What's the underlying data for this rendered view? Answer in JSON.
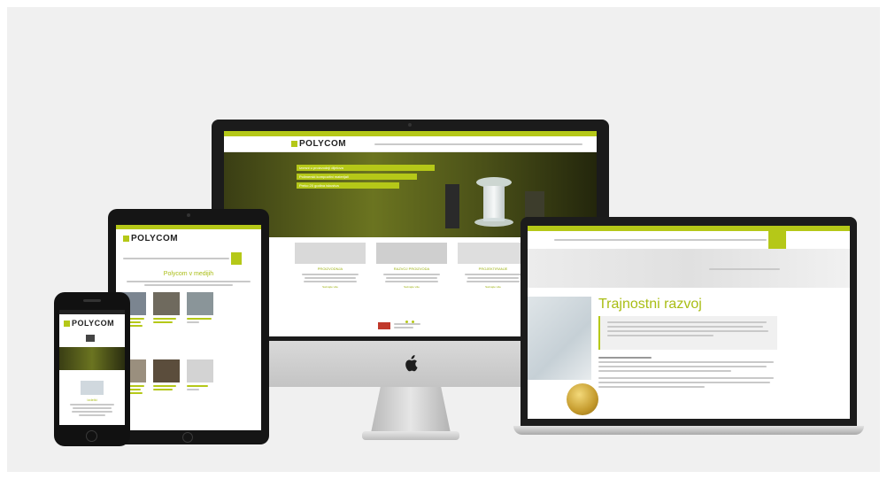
{
  "brand": {
    "name": "POLYCOM",
    "accent": "#b5c818"
  },
  "monitor": {
    "hero_bullets": [
      "Izvrsni u proizvodnji dijelova",
      "Polimerski kompozitni materijali",
      "Preko 20 godina iskustva"
    ],
    "cards": [
      {
        "title": "PROIZVODNJA",
        "button": "Saznajte više"
      },
      {
        "title": "RAZVOJ PROIZVODA",
        "button": "Saznajte više"
      },
      {
        "title": "PROJEKTIRANJE",
        "button": "Saznajte više"
      }
    ]
  },
  "laptop": {
    "page_title": "Trajnostni razvoj"
  },
  "tablet": {
    "section_title": "Polycom v medijih"
  },
  "phone": {
    "section_title": "Izdelki"
  },
  "icons": [
    "apple-logo-icon",
    "camera-icon",
    "home-button-icon"
  ]
}
